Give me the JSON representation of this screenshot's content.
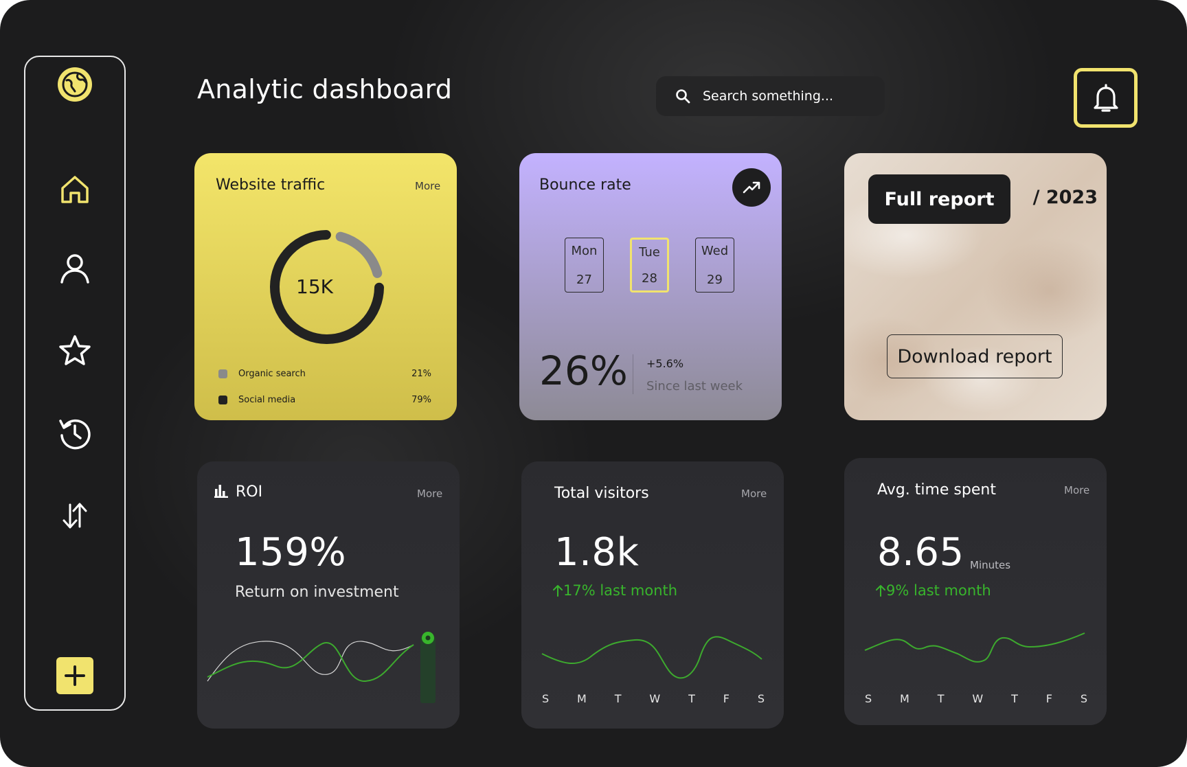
{
  "app": {
    "title": "Analytic dashboard"
  },
  "colors": {
    "accent": "#f1e36e",
    "positive": "#38b52c",
    "background": "#1c1c1d"
  },
  "sidebar": {
    "logo_icon": "globe-icon",
    "items": [
      {
        "icon": "home-icon",
        "active": true
      },
      {
        "icon": "user-icon"
      },
      {
        "icon": "star-icon"
      },
      {
        "icon": "history-icon"
      },
      {
        "icon": "sort-arrows-icon"
      }
    ],
    "add_icon": "plus-icon"
  },
  "search": {
    "placeholder": "Search something..."
  },
  "notifications": {
    "icon": "bell-icon"
  },
  "website_traffic": {
    "title": "Website traffic",
    "more": "More",
    "total": "15K",
    "legend": [
      {
        "label": "Organic search",
        "percent": "21%",
        "value": 21,
        "color": "#8a8a8a"
      },
      {
        "label": "Social media",
        "percent": "79%",
        "value": 79,
        "color": "#222222"
      }
    ]
  },
  "bounce_rate": {
    "title": "Bounce rate",
    "trend_icon": "trending-up-icon",
    "days": [
      {
        "day": "Mon",
        "date": "27"
      },
      {
        "day": "Tue",
        "date": "28",
        "selected": true
      },
      {
        "day": "Wed",
        "date": "29"
      }
    ],
    "value": "26%",
    "change": "+5.6%",
    "since": "Since last week"
  },
  "full_report": {
    "button": "Full report",
    "year": "/ 2023",
    "download": "Download report"
  },
  "roi": {
    "icon": "bar-chart-icon",
    "title": "ROI",
    "more": "More",
    "value": "159%",
    "subtitle": "Return on investment"
  },
  "total_visitors": {
    "title": "Total visitors",
    "more": "More",
    "value": "1.8k",
    "change": "17% last month",
    "change_icon": "arrow-up-icon",
    "day_labels": [
      "S",
      "M",
      "T",
      "W",
      "T",
      "F",
      "S"
    ]
  },
  "avg_time": {
    "title": "Avg. time spent",
    "more": "More",
    "value": "8.65",
    "unit": "Minutes",
    "change": "9% last month",
    "change_icon": "arrow-up-icon",
    "day_labels": [
      "S",
      "M",
      "T",
      "W",
      "T",
      "F",
      "S"
    ]
  }
}
